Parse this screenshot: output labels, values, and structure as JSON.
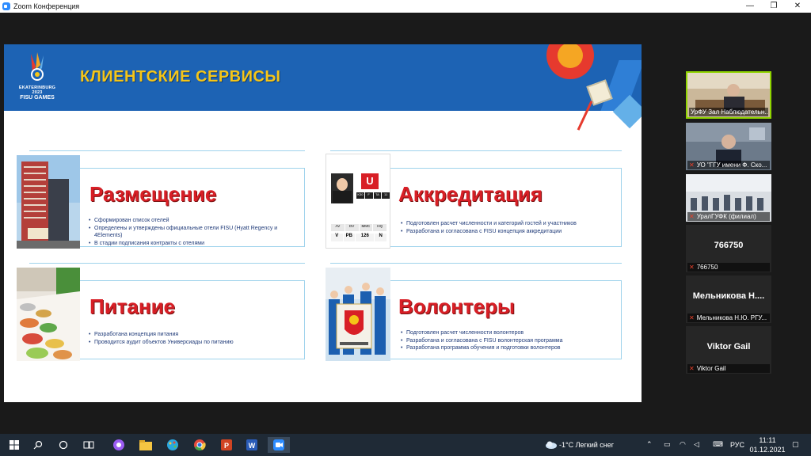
{
  "window": {
    "title": "Zoom Конференция",
    "controls": {
      "minimize": "—",
      "maximize": "❐",
      "close": "✕"
    }
  },
  "slide": {
    "logo": {
      "line1": "EKATERINBURG 2023",
      "line2": "FISU GAMES"
    },
    "title": "КЛИЕНТСКИЕ СЕРВИСЫ",
    "cards": [
      {
        "heading": "Размещение",
        "bullets": [
          "Сформирован список отелей",
          "Определены и утверждены официальные отели FISU (Hyatt Regency и 4Elements)",
          "В стадии подписания контракты с отелями"
        ]
      },
      {
        "heading": "Аккредитация",
        "bullets": [
          "Подготовлен расчет численности и категорий гостей и участников",
          "Разработана и согласована с FISU концепция аккредитации"
        ]
      },
      {
        "heading": "Питание",
        "bullets": [
          "Разработана концепция питания",
          "Проводится аудит объектов Универсиады по питанию"
        ]
      },
      {
        "heading": "Волонтеры",
        "bullets": [
          "Подготовлен расчет численности волонтеров",
          "Разработана и согласована с FISU волонтерская программа",
          "Разработана программа обучения и подготовки волонтеров"
        ]
      }
    ],
    "badge": {
      "letter": "U",
      "row1": [
        "K30",
        "F",
        "TA",
        "11"
      ],
      "row2": [
        "AV",
        "DV",
        "MMC",
        "HQ"
      ],
      "row3": [
        "V",
        "PB",
        "126",
        "N"
      ]
    }
  },
  "participants": [
    {
      "name": "УрФУ Зал Наблюдательн...",
      "type": "video",
      "active": true
    },
    {
      "name": "УО \"ГГУ имени Ф. Ско...",
      "type": "video",
      "muted": true
    },
    {
      "name": "УралГУФК (филиал)",
      "type": "video",
      "muted": true
    },
    {
      "name": "766750",
      "big": "766750",
      "type": "name",
      "muted": true
    },
    {
      "name": "Мельникова Н.Ю. РГУ...",
      "big": "Мельникова Н....",
      "type": "name",
      "muted": true
    },
    {
      "name": "Viktor Gail",
      "big": "Viktor Gail",
      "type": "name",
      "muted": true
    }
  ],
  "taskbar": {
    "weather": "-1°C  Легкий снег",
    "lang": "РУС",
    "time": "11:11",
    "date": "01.12.2021"
  },
  "colors": {
    "header_blue": "#1d63b4",
    "heading_red": "#d81f26",
    "title_yellow": "#f5c518",
    "active_border": "#8fd400"
  }
}
